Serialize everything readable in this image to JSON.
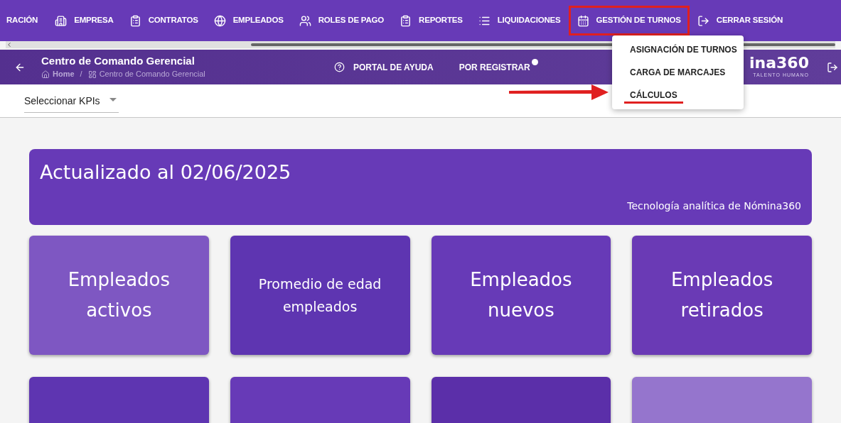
{
  "top_nav": [
    {
      "label": "RACIÓN",
      "selected": false
    },
    {
      "label": "EMPRESA",
      "selected": false
    },
    {
      "label": "CONTRATOS",
      "selected": false
    },
    {
      "label": "EMPLEADOS",
      "selected": false
    },
    {
      "label": "ROLES DE PAGO",
      "selected": false
    },
    {
      "label": "REPORTES",
      "selected": false
    },
    {
      "label": "LIQUIDACIONES",
      "selected": false
    },
    {
      "label": "GESTIÓN DE TURNOS",
      "selected": true
    },
    {
      "label": "CERRAR SESIÓN",
      "selected": false
    }
  ],
  "dropdown": {
    "items": [
      {
        "label": "ASIGNACIÓN DE TURNOS",
        "highlighted": false
      },
      {
        "label": "CARGA DE MARCAJES",
        "highlighted": false
      },
      {
        "label": "CÁLCULOS",
        "highlighted": true
      }
    ]
  },
  "header": {
    "title": "Centro de Comando Gerencial",
    "breadcrumb": [
      "Home",
      "/",
      "Centro de Comando Gerencial"
    ],
    "help": "PORTAL DE AYUDA",
    "pending": "POR REGISTRAR",
    "logo": "ina360",
    "logo_tagline": "TALENTO HUMANO"
  },
  "kpi_select": {
    "placeholder": "Seleccionar KPIs"
  },
  "banner": {
    "title": "Actualizado al 02/06/2025",
    "subtitle": "Tecnología analítica de Nómina360"
  },
  "cards": [
    {
      "label": "Empleados activos",
      "color": "#7e57c2"
    },
    {
      "label": "Promedio de edad empleados",
      "color": "#5e35b1"
    },
    {
      "label": "Empleados nuevos",
      "color": "#673ab7"
    },
    {
      "label": "Empleados retirados",
      "color": "#6a3ab5"
    },
    {
      "color": "#5e35b1"
    },
    {
      "color": "#673ab7"
    },
    {
      "color": "#5b2fa9"
    },
    {
      "color": "#9575cd"
    }
  ]
}
